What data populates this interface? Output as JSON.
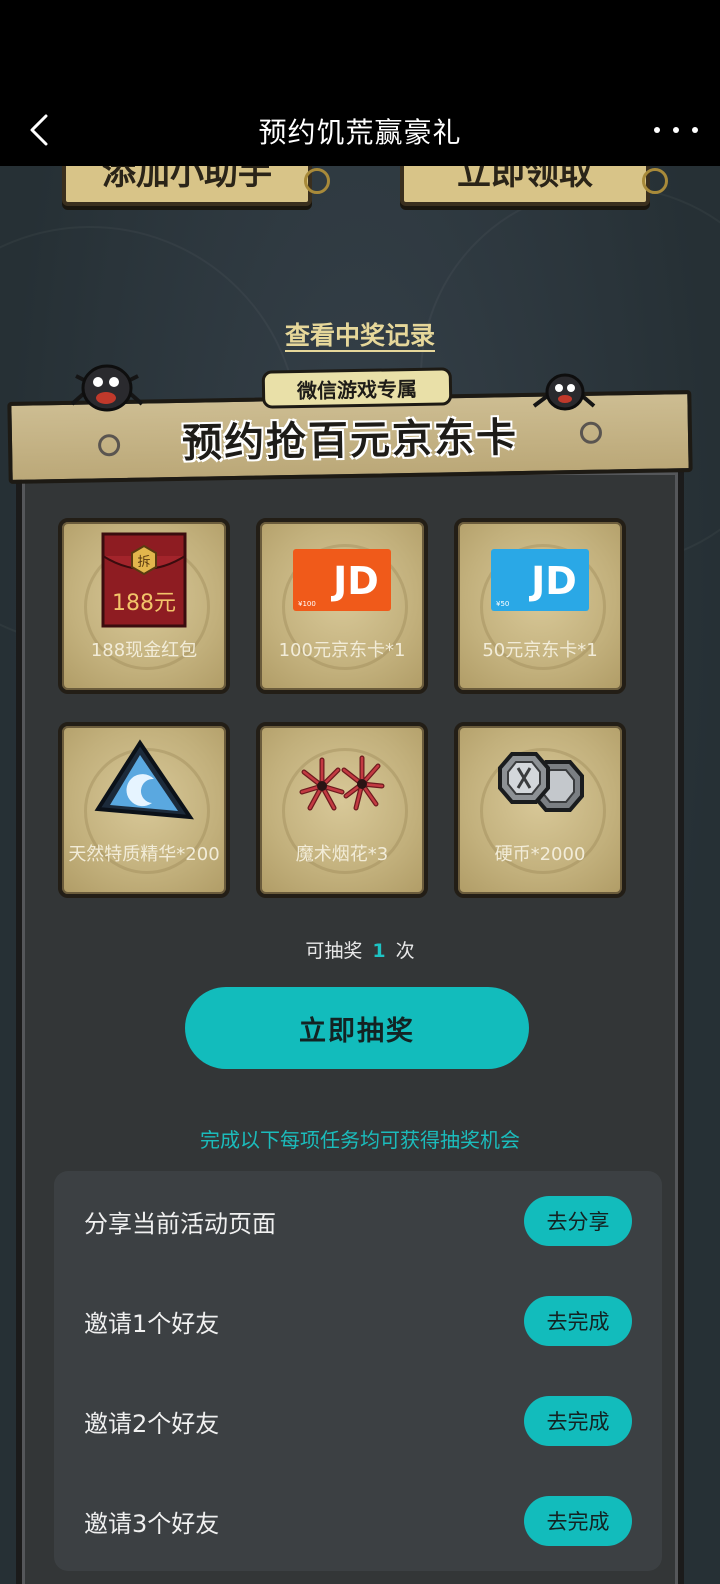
{
  "nav": {
    "title": "预约饥荒赢豪礼"
  },
  "top_buttons": {
    "add_helper": "添加小助手",
    "claim_now": "立即领取"
  },
  "record_link": "查看中奖记录",
  "banner": {
    "tag": "微信游戏专属",
    "title": "预约抢百元京东卡"
  },
  "prizes": [
    {
      "label": "188现金红包",
      "icon": "red-envelope-icon",
      "envelope_text": "188元",
      "seal_text": "拆"
    },
    {
      "label": "100元京东卡*1",
      "icon": "jd-card-orange-icon",
      "card_brand": "JD",
      "card_value": "¥100"
    },
    {
      "label": "50元京东卡*1",
      "icon": "jd-card-blue-icon",
      "card_brand": "JD",
      "card_value": "¥50"
    },
    {
      "label": "天然特质精华*200",
      "icon": "crystal-essence-icon"
    },
    {
      "label": "魔术烟花*3",
      "icon": "firework-icon"
    },
    {
      "label": "硬币*2000",
      "icon": "coins-icon"
    }
  ],
  "draw": {
    "prefix": "可抽奖",
    "count": "1",
    "suffix": "次",
    "button": "立即抽奖"
  },
  "task_hint": "完成以下每项任务均可获得抽奖机会",
  "tasks": [
    {
      "label": "分享当前活动页面",
      "button": "去分享"
    },
    {
      "label": "邀请1个好友",
      "button": "去完成"
    },
    {
      "label": "邀请2个好友",
      "button": "去完成"
    },
    {
      "label": "邀请3个好友",
      "button": "去完成"
    }
  ],
  "colors": {
    "accent": "#12bcbc",
    "card": "#c9b783",
    "background": "#2b3338"
  }
}
